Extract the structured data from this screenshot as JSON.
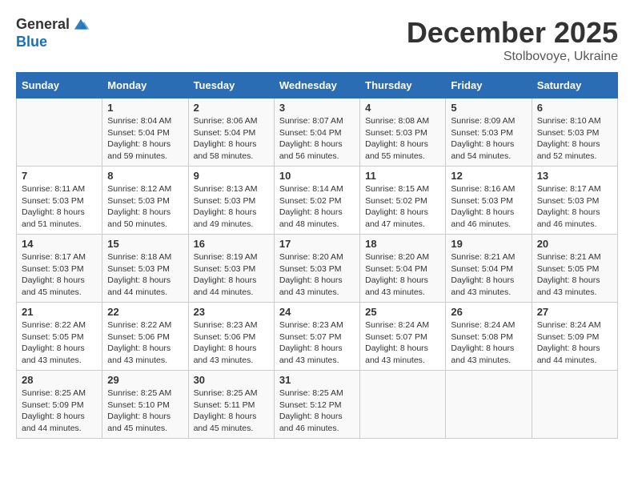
{
  "header": {
    "logo_line1": "General",
    "logo_line2": "Blue",
    "month": "December 2025",
    "location": "Stolbovoye, Ukraine"
  },
  "days_of_week": [
    "Sunday",
    "Monday",
    "Tuesday",
    "Wednesday",
    "Thursday",
    "Friday",
    "Saturday"
  ],
  "weeks": [
    [
      {
        "day": "",
        "sunrise": "",
        "sunset": "",
        "daylight": ""
      },
      {
        "day": "1",
        "sunrise": "Sunrise: 8:04 AM",
        "sunset": "Sunset: 5:04 PM",
        "daylight": "Daylight: 8 hours and 59 minutes."
      },
      {
        "day": "2",
        "sunrise": "Sunrise: 8:06 AM",
        "sunset": "Sunset: 5:04 PM",
        "daylight": "Daylight: 8 hours and 58 minutes."
      },
      {
        "day": "3",
        "sunrise": "Sunrise: 8:07 AM",
        "sunset": "Sunset: 5:04 PM",
        "daylight": "Daylight: 8 hours and 56 minutes."
      },
      {
        "day": "4",
        "sunrise": "Sunrise: 8:08 AM",
        "sunset": "Sunset: 5:03 PM",
        "daylight": "Daylight: 8 hours and 55 minutes."
      },
      {
        "day": "5",
        "sunrise": "Sunrise: 8:09 AM",
        "sunset": "Sunset: 5:03 PM",
        "daylight": "Daylight: 8 hours and 54 minutes."
      },
      {
        "day": "6",
        "sunrise": "Sunrise: 8:10 AM",
        "sunset": "Sunset: 5:03 PM",
        "daylight": "Daylight: 8 hours and 52 minutes."
      }
    ],
    [
      {
        "day": "7",
        "sunrise": "Sunrise: 8:11 AM",
        "sunset": "Sunset: 5:03 PM",
        "daylight": "Daylight: 8 hours and 51 minutes."
      },
      {
        "day": "8",
        "sunrise": "Sunrise: 8:12 AM",
        "sunset": "Sunset: 5:03 PM",
        "daylight": "Daylight: 8 hours and 50 minutes."
      },
      {
        "day": "9",
        "sunrise": "Sunrise: 8:13 AM",
        "sunset": "Sunset: 5:03 PM",
        "daylight": "Daylight: 8 hours and 49 minutes."
      },
      {
        "day": "10",
        "sunrise": "Sunrise: 8:14 AM",
        "sunset": "Sunset: 5:02 PM",
        "daylight": "Daylight: 8 hours and 48 minutes."
      },
      {
        "day": "11",
        "sunrise": "Sunrise: 8:15 AM",
        "sunset": "Sunset: 5:02 PM",
        "daylight": "Daylight: 8 hours and 47 minutes."
      },
      {
        "day": "12",
        "sunrise": "Sunrise: 8:16 AM",
        "sunset": "Sunset: 5:03 PM",
        "daylight": "Daylight: 8 hours and 46 minutes."
      },
      {
        "day": "13",
        "sunrise": "Sunrise: 8:17 AM",
        "sunset": "Sunset: 5:03 PM",
        "daylight": "Daylight: 8 hours and 46 minutes."
      }
    ],
    [
      {
        "day": "14",
        "sunrise": "Sunrise: 8:17 AM",
        "sunset": "Sunset: 5:03 PM",
        "daylight": "Daylight: 8 hours and 45 minutes."
      },
      {
        "day": "15",
        "sunrise": "Sunrise: 8:18 AM",
        "sunset": "Sunset: 5:03 PM",
        "daylight": "Daylight: 8 hours and 44 minutes."
      },
      {
        "day": "16",
        "sunrise": "Sunrise: 8:19 AM",
        "sunset": "Sunset: 5:03 PM",
        "daylight": "Daylight: 8 hours and 44 minutes."
      },
      {
        "day": "17",
        "sunrise": "Sunrise: 8:20 AM",
        "sunset": "Sunset: 5:03 PM",
        "daylight": "Daylight: 8 hours and 43 minutes."
      },
      {
        "day": "18",
        "sunrise": "Sunrise: 8:20 AM",
        "sunset": "Sunset: 5:04 PM",
        "daylight": "Daylight: 8 hours and 43 minutes."
      },
      {
        "day": "19",
        "sunrise": "Sunrise: 8:21 AM",
        "sunset": "Sunset: 5:04 PM",
        "daylight": "Daylight: 8 hours and 43 minutes."
      },
      {
        "day": "20",
        "sunrise": "Sunrise: 8:21 AM",
        "sunset": "Sunset: 5:05 PM",
        "daylight": "Daylight: 8 hours and 43 minutes."
      }
    ],
    [
      {
        "day": "21",
        "sunrise": "Sunrise: 8:22 AM",
        "sunset": "Sunset: 5:05 PM",
        "daylight": "Daylight: 8 hours and 43 minutes."
      },
      {
        "day": "22",
        "sunrise": "Sunrise: 8:22 AM",
        "sunset": "Sunset: 5:06 PM",
        "daylight": "Daylight: 8 hours and 43 minutes."
      },
      {
        "day": "23",
        "sunrise": "Sunrise: 8:23 AM",
        "sunset": "Sunset: 5:06 PM",
        "daylight": "Daylight: 8 hours and 43 minutes."
      },
      {
        "day": "24",
        "sunrise": "Sunrise: 8:23 AM",
        "sunset": "Sunset: 5:07 PM",
        "daylight": "Daylight: 8 hours and 43 minutes."
      },
      {
        "day": "25",
        "sunrise": "Sunrise: 8:24 AM",
        "sunset": "Sunset: 5:07 PM",
        "daylight": "Daylight: 8 hours and 43 minutes."
      },
      {
        "day": "26",
        "sunrise": "Sunrise: 8:24 AM",
        "sunset": "Sunset: 5:08 PM",
        "daylight": "Daylight: 8 hours and 43 minutes."
      },
      {
        "day": "27",
        "sunrise": "Sunrise: 8:24 AM",
        "sunset": "Sunset: 5:09 PM",
        "daylight": "Daylight: 8 hours and 44 minutes."
      }
    ],
    [
      {
        "day": "28",
        "sunrise": "Sunrise: 8:25 AM",
        "sunset": "Sunset: 5:09 PM",
        "daylight": "Daylight: 8 hours and 44 minutes."
      },
      {
        "day": "29",
        "sunrise": "Sunrise: 8:25 AM",
        "sunset": "Sunset: 5:10 PM",
        "daylight": "Daylight: 8 hours and 45 minutes."
      },
      {
        "day": "30",
        "sunrise": "Sunrise: 8:25 AM",
        "sunset": "Sunset: 5:11 PM",
        "daylight": "Daylight: 8 hours and 45 minutes."
      },
      {
        "day": "31",
        "sunrise": "Sunrise: 8:25 AM",
        "sunset": "Sunset: 5:12 PM",
        "daylight": "Daylight: 8 hours and 46 minutes."
      },
      {
        "day": "",
        "sunrise": "",
        "sunset": "",
        "daylight": ""
      },
      {
        "day": "",
        "sunrise": "",
        "sunset": "",
        "daylight": ""
      },
      {
        "day": "",
        "sunrise": "",
        "sunset": "",
        "daylight": ""
      }
    ]
  ]
}
